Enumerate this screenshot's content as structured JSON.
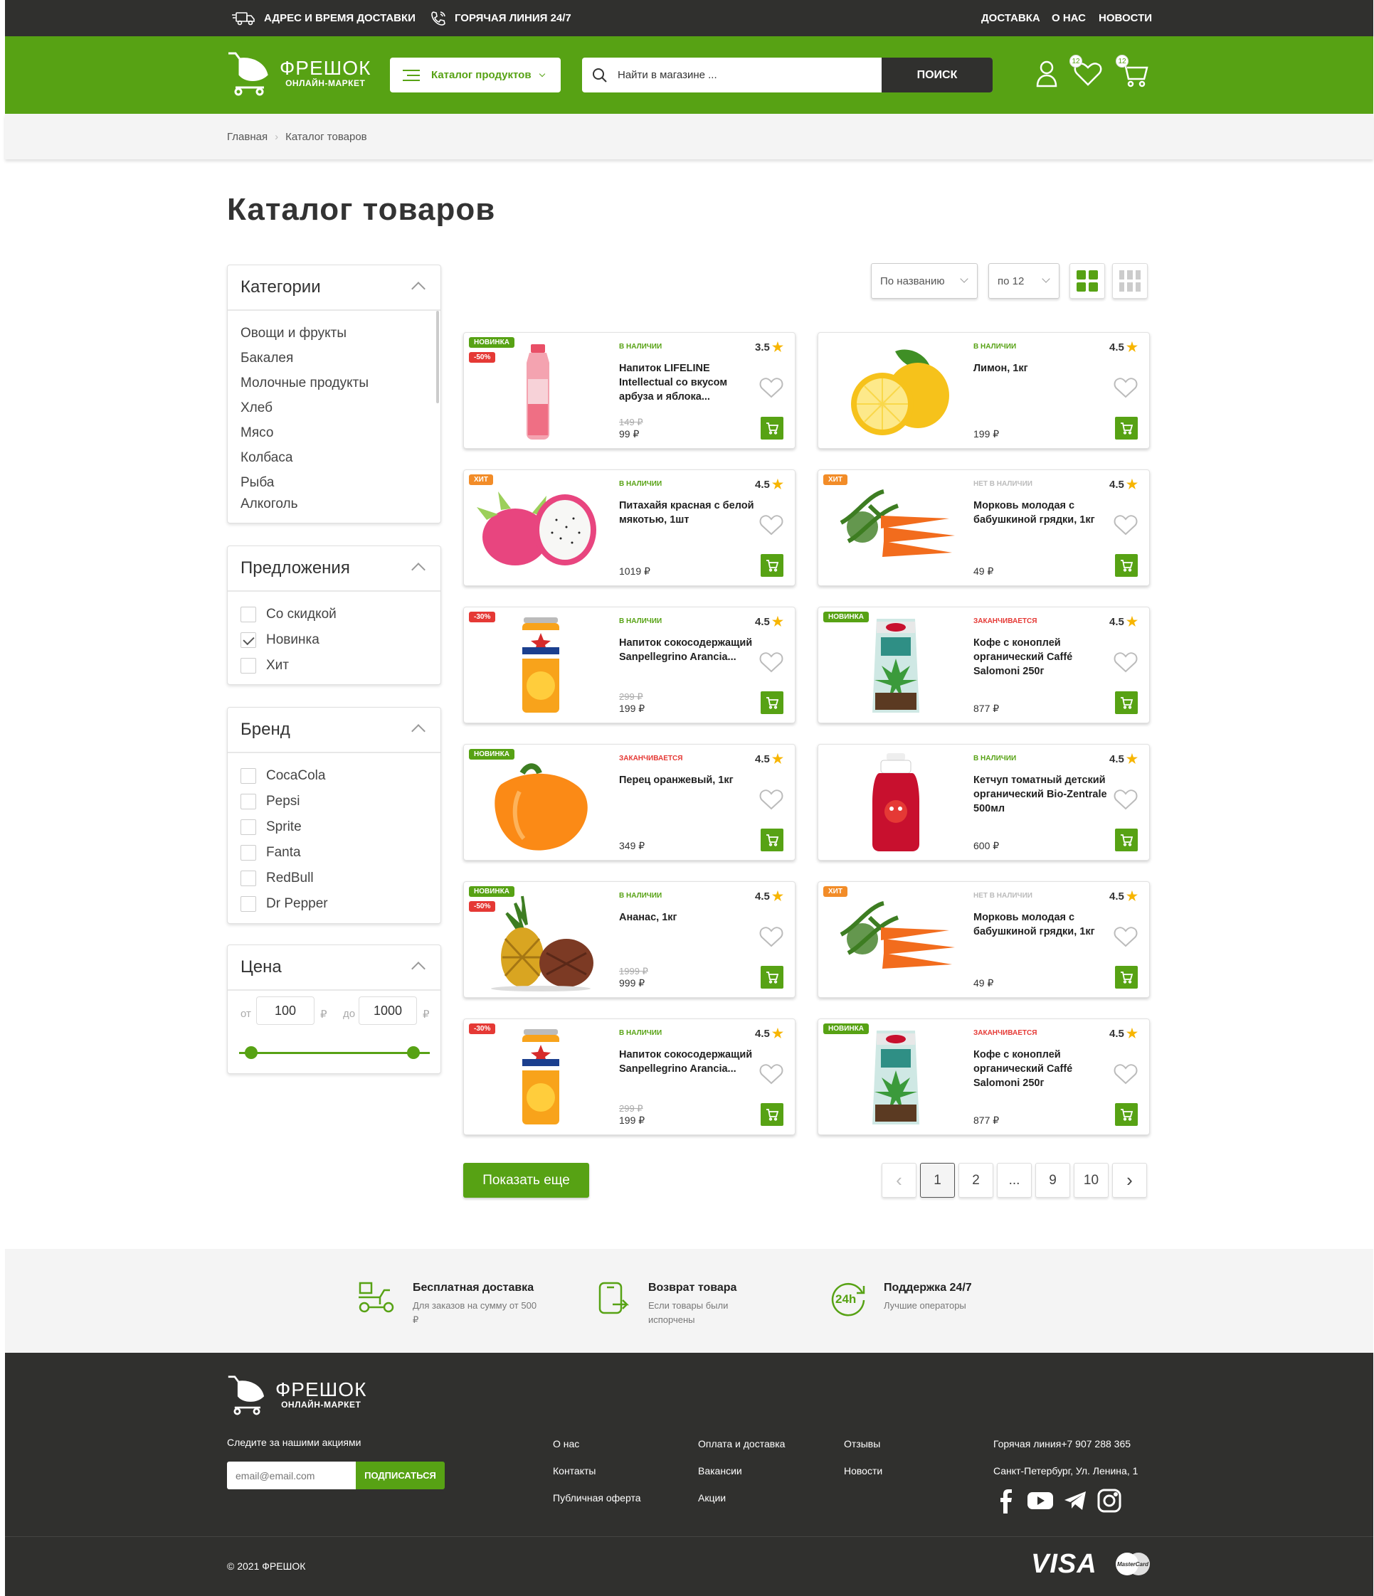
{
  "topbar": {
    "address": "АДРЕС И ВРЕМЯ ДОСТАВКИ",
    "hotline": "ГОРЯЧАЯ ЛИНИЯ 24/7",
    "links": [
      "ДОСТАВКА",
      "О НАС",
      "НОВОСТИ"
    ]
  },
  "header": {
    "logo_title": "ФРЕШОК",
    "logo_sub": "ОНЛАЙН-МАРКЕТ",
    "catalog_button": "Каталог продуктов",
    "search_placeholder": "Найти в магазине ...",
    "search_button": "ПОИСК",
    "favorites_count": "12",
    "cart_count": "12"
  },
  "breadcrumbs": [
    "Главная",
    "Каталог товаров"
  ],
  "page_title": "Каталог товаров",
  "filters": {
    "categories": {
      "title": "Категории",
      "items": [
        "Овощи и фрукты",
        "Бакалея",
        "Молочные продукты",
        "Хлеб",
        "Мясо",
        "Колбаса",
        "Рыба",
        "Алкоголь"
      ]
    },
    "offers": {
      "title": "Предложения",
      "items": [
        {
          "label": "Со скидкой",
          "checked": false
        },
        {
          "label": "Новинка",
          "checked": true
        },
        {
          "label": "Хит",
          "checked": false
        }
      ]
    },
    "brand": {
      "title": "Бренд",
      "items": [
        "CocaCola",
        "Pepsi",
        "Sprite",
        "Fanta",
        "RedBull",
        "Dr Pepper"
      ]
    },
    "price": {
      "title": "Цена",
      "from_label": "от",
      "to_label": "до",
      "from": "100",
      "to": "1000",
      "currency": "₽"
    }
  },
  "sort": {
    "by": "По названию",
    "per_page": "по 12"
  },
  "products": [
    {
      "tags": [
        "НОВИНКА",
        "-50%"
      ],
      "stock": "В НАЛИЧИИ",
      "rating": "3.5",
      "name": "Напиток LIFELINE Intellectual со вкусом арбуза и яблока...",
      "old_price": "149 ₽",
      "price": "99 ₽",
      "image": "drink-bottle"
    },
    {
      "tags": [],
      "stock": "В НАЛИЧИИ",
      "rating": "4.5",
      "name": "Лимон, 1кг",
      "old_price": "",
      "price": "199 ₽",
      "image": "lemon"
    },
    {
      "tags": [
        "ХИТ"
      ],
      "stock": "В НАЛИЧИИ",
      "rating": "4.5",
      "name": "Питахайя красная с белой мякотью, 1шт",
      "old_price": "",
      "price": "1019 ₽",
      "image": "pitaya"
    },
    {
      "tags": [
        "ХИТ"
      ],
      "stock": "НЕТ В НАЛИЧИИ",
      "rating": "4.5",
      "name": "Морковь молодая с бабушкиной грядки, 1кг",
      "old_price": "",
      "price": "49 ₽",
      "image": "carrot"
    },
    {
      "tags": [
        "-30%"
      ],
      "stock": "В НАЛИЧИИ",
      "rating": "4.5",
      "name": "Напиток сокосодержащий Sanpellegrino Arancia...",
      "old_price": "299 ₽",
      "price": "199 ₽",
      "image": "can"
    },
    {
      "tags": [
        "НОВИНКА"
      ],
      "stock": "ЗАКАНЧИВАЕТСЯ",
      "rating": "4.5",
      "name": "Кофе с коноплей органический Caffé Salomoni 250г",
      "old_price": "",
      "price": "877 ₽",
      "image": "coffee"
    },
    {
      "tags": [
        "НОВИНКА"
      ],
      "stock": "ЗАКАНЧИВАЕТСЯ",
      "rating": "4.5",
      "name": "Перец оранжевый, 1кг",
      "old_price": "",
      "price": "349 ₽",
      "image": "pepper"
    },
    {
      "tags": [],
      "stock": "В НАЛИЧИИ",
      "rating": "4.5",
      "name": "Кетчуп томатный детский органический Bio-Zentrale 500мл",
      "old_price": "",
      "price": "600 ₽",
      "image": "ketchup"
    },
    {
      "tags": [
        "НОВИНКА",
        "-50%"
      ],
      "stock": "В НАЛИЧИИ",
      "rating": "4.5",
      "name": "Ананас, 1кг",
      "old_price": "1999 ₽",
      "price": "999 ₽",
      "image": "pineapple"
    },
    {
      "tags": [
        "ХИТ"
      ],
      "stock": "НЕТ В НАЛИЧИИ",
      "rating": "4.5",
      "name": "Морковь молодая с бабушкиной грядки, 1кг",
      "old_price": "",
      "price": "49 ₽",
      "image": "carrot"
    },
    {
      "tags": [
        "-30%"
      ],
      "stock": "В НАЛИЧИИ",
      "rating": "4.5",
      "name": "Напиток сокосодержащий Sanpellegrino Arancia...",
      "old_price": "299 ₽",
      "price": "199 ₽",
      "image": "can"
    },
    {
      "tags": [
        "НОВИНКА"
      ],
      "stock": "ЗАКАНЧИВАЕТСЯ",
      "rating": "4.5",
      "name": "Кофе с коноплей органический Caffé Salomoni 250г",
      "old_price": "",
      "price": "877 ₽",
      "image": "coffee"
    }
  ],
  "show_more": "Показать еще",
  "pagination": [
    "1",
    "2",
    "...",
    "9",
    "10"
  ],
  "features": [
    {
      "title": "Бесплатная доставка",
      "text": "Для заказов на сумму от 500 ₽",
      "icon": "scooter-icon"
    },
    {
      "title": "Возврат товара",
      "text": "Если товары были испорчены",
      "icon": "return-icon"
    },
    {
      "title": "Поддержка 24/7",
      "text": "Лучшие операторы",
      "icon": "support-24h-icon"
    }
  ],
  "footer": {
    "logo_title": "ФРЕШОК",
    "logo_sub": "ОНЛАЙН-МАРКЕТ",
    "follow": "Следите за нашими акциями",
    "email_placeholder": "email@email.com",
    "subscribe": "ПОДПИСАТЬСЯ",
    "col1": [
      "О нас",
      "Контакты",
      "Публичная оферта"
    ],
    "col2": [
      "Оплата и доставка",
      "Вакансии",
      "Акции"
    ],
    "col3": [
      "Отзывы",
      "Новости"
    ],
    "hotline": "Горячая линия+7 907 288 365",
    "address": "Санкт-Петербург, Ул. Ленина, 1",
    "copyright": "© 2021 ФРЕШОК",
    "payment": [
      "VISA",
      "MasterCard"
    ]
  },
  "colors": {
    "brand_green": "#57a214",
    "dark": "#30302e",
    "hit": "#f28c28",
    "sale": "#e53935",
    "star": "#f7b500"
  }
}
